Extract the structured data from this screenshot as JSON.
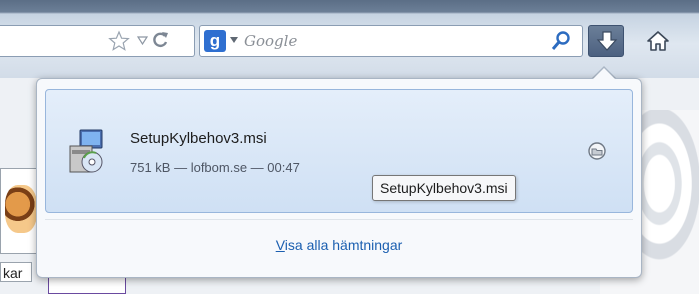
{
  "toolbar": {
    "search": {
      "placeholder": "Google"
    }
  },
  "downloads_panel": {
    "item": {
      "file_name": "SetupKylbehov3.msi",
      "status": "751 kB — lofbom.se — 00:47",
      "tooltip": "SetupKylbehov3.msi"
    },
    "show_all": {
      "accesskey": "V",
      "rest": "isa alla hämtningar"
    }
  },
  "page": {
    "partial_text": "kar"
  },
  "colors": {
    "panel_item_bg": "#cfe0f4",
    "link": "#1b5fb0",
    "downloads_button": "#4c6180"
  }
}
